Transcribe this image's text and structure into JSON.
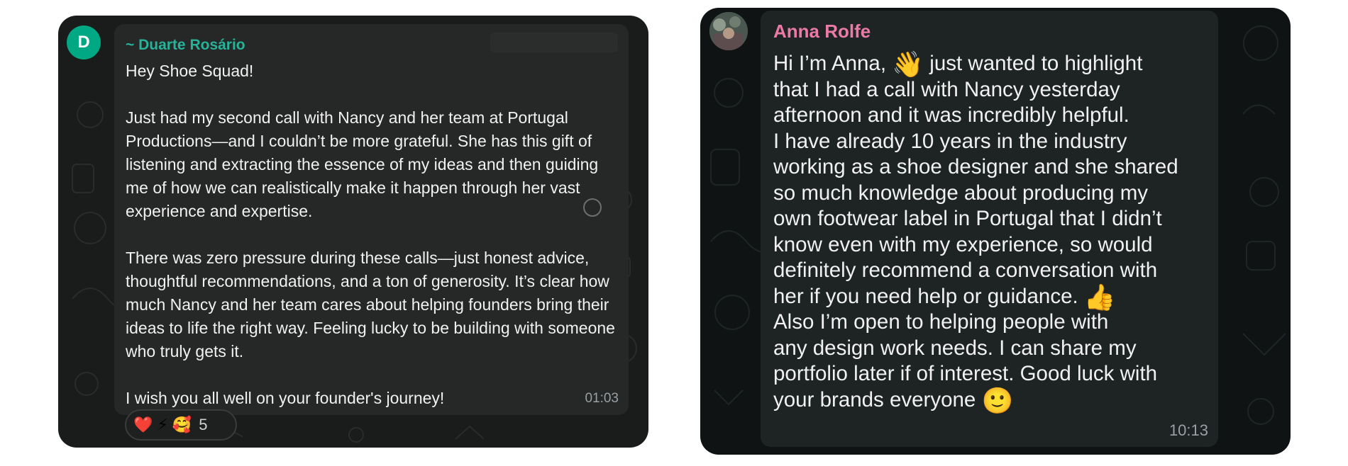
{
  "left_card": {
    "avatar_letter": "D",
    "sender": "~ Duarte Rosário",
    "paragraphs": [
      "Hey Shoe Squad!",
      "Just had my second call with Nancy and her team at Portugal Productions—and I couldn’t be more grateful. She has this gift of listening and extracting the essence of my ideas and then guiding me of how we can realistically make it happen through her vast experience and expertise.",
      "There was zero pressure during these calls—just honest advice, thoughtful recommendations, and a ton of generosity. It’s clear how much Nancy and her team cares about helping founders bring their ideas to life the right way. Feeling lucky to be building with someone who truly gets it.",
      "I wish you all well on your founder's journey!"
    ],
    "time": "01:03",
    "reactions": [
      "❤️",
      "⚡",
      "🥰"
    ],
    "reaction_count": "5"
  },
  "right_card": {
    "sender": "Anna Rolfe",
    "lines": {
      "l1a": "Hi I’m Anna,",
      "wave": "👋",
      "l1b": "just wanted to highlight",
      "l2": "that I had a call with Nancy yesterday",
      "l3": "afternoon and it was incredibly helpful.",
      "l4": "I have already 10 years in the industry",
      "l5": "working as a shoe designer and she shared",
      "l6": "so much knowledge about producing my",
      "l7": "own footwear label in Portugal that I didn’t",
      "l8": "know even with my experience, so would",
      "l9": "definitely recommend a conversation with",
      "l10": "her if you need help or guidance.",
      "thumbs": "👍",
      "l11": "Also I’m open to helping people with",
      "l12": "any design work needs. I  can share my",
      "l13": "portfolio later if of interest. Good luck with",
      "l14": "your brands everyone",
      "smile": "🙂"
    },
    "time": "10:13"
  },
  "colors": {
    "left_sender": "#27b29a",
    "right_sender": "#ec7aa7",
    "avatar": "#00a884"
  }
}
